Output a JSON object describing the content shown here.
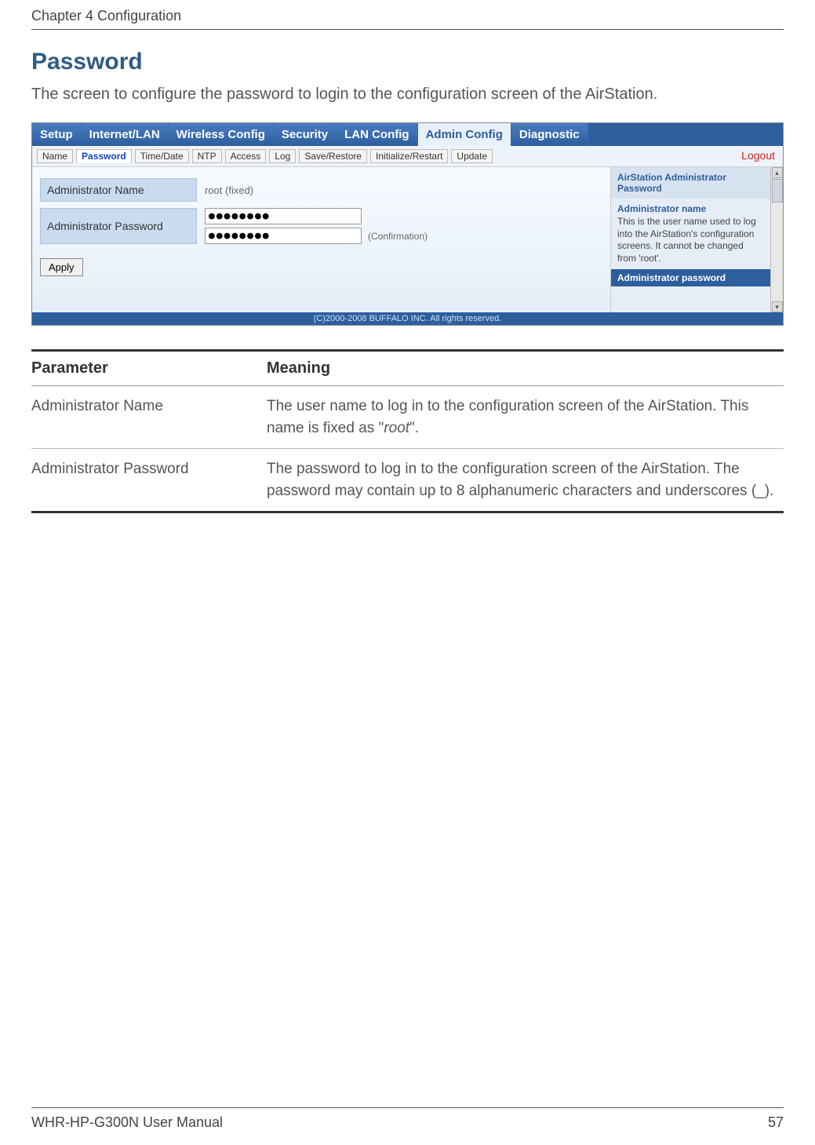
{
  "header": {
    "chapter": "Chapter 4  Configuration"
  },
  "section": {
    "title": "Password",
    "intro": "The screen to configure the password to login to the configuration screen of the AirStation."
  },
  "tabs": [
    "Setup",
    "Internet/LAN",
    "Wireless Config",
    "Security",
    "LAN Config",
    "Admin Config",
    "Diagnostic"
  ],
  "active_tab": "Admin Config",
  "subtabs": [
    "Name",
    "Password",
    "Time/Date",
    "NTP",
    "Access",
    "Log",
    "Save/Restore",
    "Initialize/Restart",
    "Update"
  ],
  "active_subtab": "Password",
  "logout": "Logout",
  "form": {
    "admin_name_label": "Administrator Name",
    "admin_name_value": "root (fixed)",
    "admin_pw_label": "Administrator Password",
    "pw_mask": "●●●●●●●●",
    "confirmation": "(Confirmation)",
    "apply": "Apply"
  },
  "help": {
    "title": "AirStation Administrator Password",
    "sub1": "Administrator name",
    "text1": "This is the user name used to log into the AirStation's configuration screens. It cannot be changed from 'root'.",
    "sub2": "Administrator password"
  },
  "copyright": "(C)2000-2008 BUFFALO INC. All rights reserved.",
  "param_table": {
    "h1": "Parameter",
    "h2": "Meaning",
    "rows": [
      {
        "p": "Administrator Name",
        "m_pre": "The user name to log in to the configuration screen of the AirStation. This name is fixed as \"",
        "m_italic": "root",
        "m_post": "\"."
      },
      {
        "p": "Administrator Password",
        "m_pre": "The password to log in to the configuration screen of the AirStation. The password may contain up to 8 alphanumeric characters and underscores (_).",
        "m_italic": "",
        "m_post": ""
      }
    ]
  },
  "footer": {
    "manual": "WHR-HP-G300N User Manual",
    "page": "57"
  }
}
